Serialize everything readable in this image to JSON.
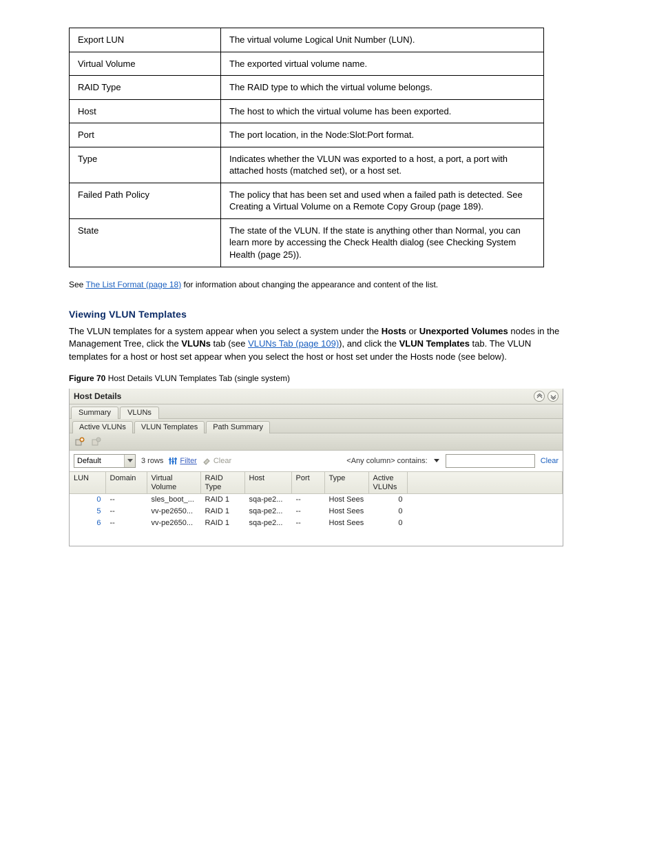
{
  "properties_table": {
    "rows": [
      {
        "k": "Export LUN",
        "v": "The virtual volume Logical Unit Number (LUN)."
      },
      {
        "k": "Virtual Volume",
        "v": "The exported virtual volume name."
      },
      {
        "k": "RAID Type",
        "v": "The RAID type to which the virtual volume belongs."
      },
      {
        "k": "Host",
        "v": "The host to which the virtual volume has been exported."
      },
      {
        "k": "Port",
        "v": "The port location, in the Node:Slot:Port format."
      },
      {
        "k": "Type",
        "v": "Indicates whether the VLUN was exported to a host, a port, a port with attached hosts (matched set), or a host set."
      },
      {
        "k": "Failed Path Policy",
        "v": "The policy that has been set and used when a failed path is detected. See Creating a Virtual Volume on a Remote Copy Group (page 189)."
      },
      {
        "k": "State",
        "v": "The state of the VLUN. If the state is anything other than Normal, you can learn more by accessing the Check Health dialog (see Checking System Health (page 25))."
      }
    ]
  },
  "properties_note_prefix": "See ",
  "properties_note_link": "The List Format (page 18)",
  "properties_note_suffix": " for information about changing the appearance and content of the list.",
  "section_heading": "Viewing VLUN Templates",
  "para1_prefix": "The VLUN templates for a system appear when you select a system under the ",
  "para1_bold1": "Hosts",
  "para1_mid1": " or ",
  "para1_bold2": "Unexported Volumes",
  "para1_mid2": " nodes in the Management Tree, click the ",
  "para1_bold3": "VLUNs",
  "para1_mid3": " tab (see ",
  "para1_link": "VLUNs Tab (page 109)",
  "para1_mid4": "), and click the ",
  "para1_bold4": "VLUN Templates",
  "para1_end": " tab. The VLUN templates for a host or host set appear when you select the host or host set under the Hosts node (see below).",
  "figure_caption_label": "Figure 70",
  "figure_caption_text": " Host Details VLUN Templates Tab (single system)",
  "ui": {
    "panel_title": "Host Details",
    "tabs_level1": [
      {
        "label": "Summary",
        "active": false
      },
      {
        "label": "VLUNs",
        "active": true
      }
    ],
    "tabs_level2": [
      {
        "label": "Active VLUNs",
        "active": false
      },
      {
        "label": "VLUN Templates",
        "active": true
      },
      {
        "label": "Path Summary",
        "active": false
      }
    ],
    "filter_combo_value": "Default",
    "rows_label": "3 rows",
    "filter_btn_label": "Filter",
    "clear_btn_label": "Clear",
    "anycol_label": "<Any column> contains:",
    "search_value": "",
    "clear_link_label": "Clear",
    "columns": [
      "LUN",
      "Domain",
      "Virtual Volume",
      "RAID Type",
      "Host",
      "Port",
      "Type",
      "Active VLUNs"
    ],
    "rows": [
      {
        "lun": "0",
        "domain": "--",
        "vv": "sles_boot_...",
        "raid": "RAID 1",
        "host": "sqa-pe2...",
        "port": "--",
        "type": "Host Sees",
        "active": "0"
      },
      {
        "lun": "5",
        "domain": "--",
        "vv": "vv-pe2650...",
        "raid": "RAID 1",
        "host": "sqa-pe2...",
        "port": "--",
        "type": "Host Sees",
        "active": "0"
      },
      {
        "lun": "6",
        "domain": "--",
        "vv": "vv-pe2650...",
        "raid": "RAID 1",
        "host": "sqa-pe2...",
        "port": "--",
        "type": "Host Sees",
        "active": "0"
      }
    ]
  }
}
